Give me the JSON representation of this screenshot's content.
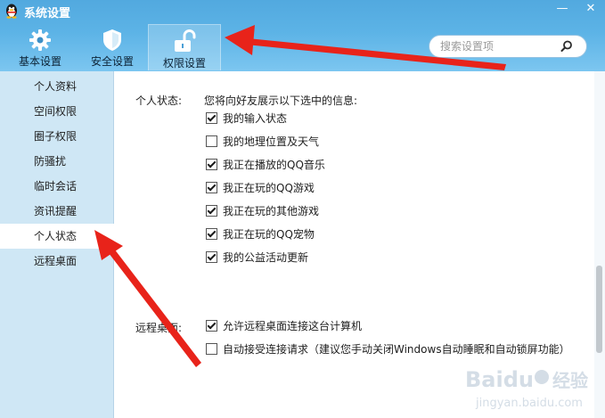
{
  "window": {
    "title": "系统设置",
    "min_glyph": "—",
    "close_glyph": "✕"
  },
  "tabs": [
    {
      "label": "基本设置",
      "icon": "gear-icon"
    },
    {
      "label": "安全设置",
      "icon": "shield-icon"
    },
    {
      "label": "权限设置",
      "icon": "unlock-icon",
      "active": true
    }
  ],
  "search": {
    "placeholder": "搜索设置项",
    "icon": "search-icon"
  },
  "sidebar": {
    "items": [
      {
        "label": "个人资料"
      },
      {
        "label": "空间权限"
      },
      {
        "label": "圈子权限"
      },
      {
        "label": "防骚扰"
      },
      {
        "label": "临时会话"
      },
      {
        "label": "资讯提醒"
      },
      {
        "label": "个人状态",
        "active": true
      },
      {
        "label": "远程桌面"
      }
    ]
  },
  "personal_status": {
    "label": "个人状态:",
    "description": "您将向好友展示以下选中的信息:",
    "options": [
      {
        "label": "我的输入状态",
        "checked": true
      },
      {
        "label": "我的地理位置及天气",
        "checked": false
      },
      {
        "label": "我正在播放的QQ音乐",
        "checked": true
      },
      {
        "label": "我正在玩的QQ游戏",
        "checked": true
      },
      {
        "label": "我正在玩的其他游戏",
        "checked": true
      },
      {
        "label": "我正在玩的QQ宠物",
        "checked": true
      },
      {
        "label": "我的公益活动更新",
        "checked": true
      }
    ]
  },
  "remote_desktop": {
    "label": "远程桌面:",
    "options": [
      {
        "label": "允许远程桌面连接这台计算机",
        "checked": true
      },
      {
        "label": "自动接受连接请求（建议您手动关闭Windows自动睡眠和自动锁屏功能）",
        "checked": false
      }
    ]
  },
  "watermark": {
    "brand": "Baidu",
    "sub": "经验",
    "url": "jingyan.baidu.com"
  },
  "colors": {
    "header": "#5cb3e6",
    "sidebar": "#cfe7f5",
    "arrow": "#e8231a"
  }
}
